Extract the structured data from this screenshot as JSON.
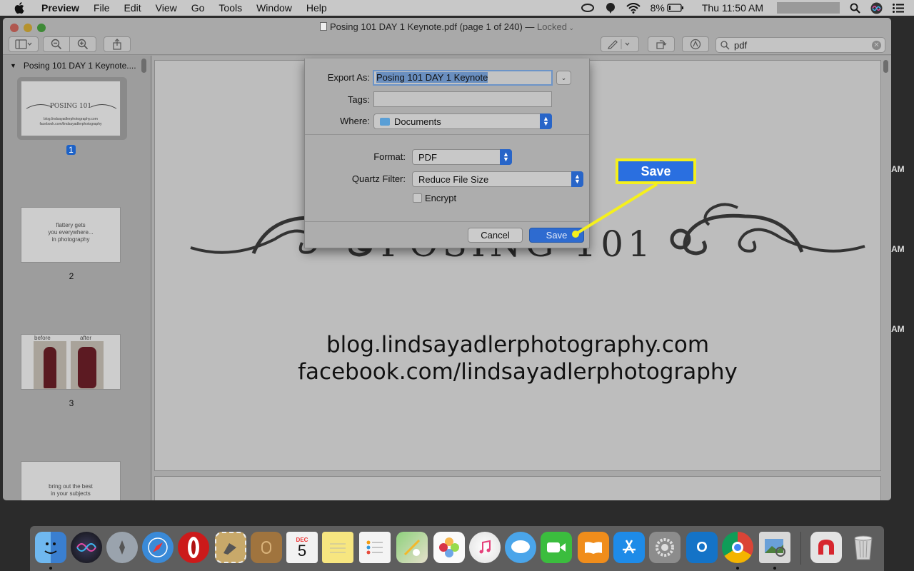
{
  "menubar": {
    "app_name": "Preview",
    "menus": [
      "File",
      "Edit",
      "View",
      "Go",
      "Tools",
      "Window",
      "Help"
    ],
    "battery": "8%",
    "clock": "Thu 11:50 AM"
  },
  "window": {
    "title": "Posing 101 DAY 1 Keynote.pdf (page 1 of 240)",
    "locked_label": "Locked",
    "search_value": "pdf"
  },
  "sidebar": {
    "header": "Posing 101 DAY 1 Keynote....",
    "pages": [
      {
        "number": "1",
        "lines": [
          "POSING 101",
          "blog.lindsayadlerphotography.com",
          "facebook.com/lindsayadlerphotography"
        ]
      },
      {
        "number": "2",
        "lines": [
          "flattery gets",
          "you everywhere...",
          "in photography"
        ]
      },
      {
        "number": "3",
        "lines": [
          "before",
          "after"
        ]
      },
      {
        "number": "",
        "lines": [
          "bring out the best",
          "in your subjects"
        ]
      }
    ]
  },
  "document": {
    "title": "POSING 101",
    "line1": "blog.lindsayadlerphotography.com",
    "line2": "facebook.com/lindsayadlerphotography"
  },
  "dialog": {
    "export_as_label": "Export As:",
    "export_as_value": "Posing 101 DAY 1 Keynote",
    "tags_label": "Tags:",
    "where_label": "Where:",
    "where_value": "Documents",
    "format_label": "Format:",
    "format_value": "PDF",
    "quartz_label": "Quartz Filter:",
    "quartz_value": "Reduce File Size",
    "encrypt_label": "Encrypt",
    "cancel": "Cancel",
    "save": "Save"
  },
  "callout": {
    "label": "Save"
  },
  "edge_text": [
    "AM",
    "AM",
    "AM"
  ],
  "dock": {
    "calendar_month": "DEC",
    "calendar_day": "5",
    "apps": [
      "finder",
      "siri",
      "launchpad",
      "safari",
      "opera",
      "mail-stamp",
      "contacts",
      "calendar",
      "notes",
      "reminders",
      "maps",
      "photos",
      "itunes",
      "messages",
      "facetime",
      "ibooks",
      "app-store",
      "system-preferences",
      "outlook",
      "chrome",
      "preview",
      "magnet",
      "trash"
    ]
  },
  "colors": {
    "accent": "#1d62c7",
    "highlight": "#f5f01c"
  }
}
